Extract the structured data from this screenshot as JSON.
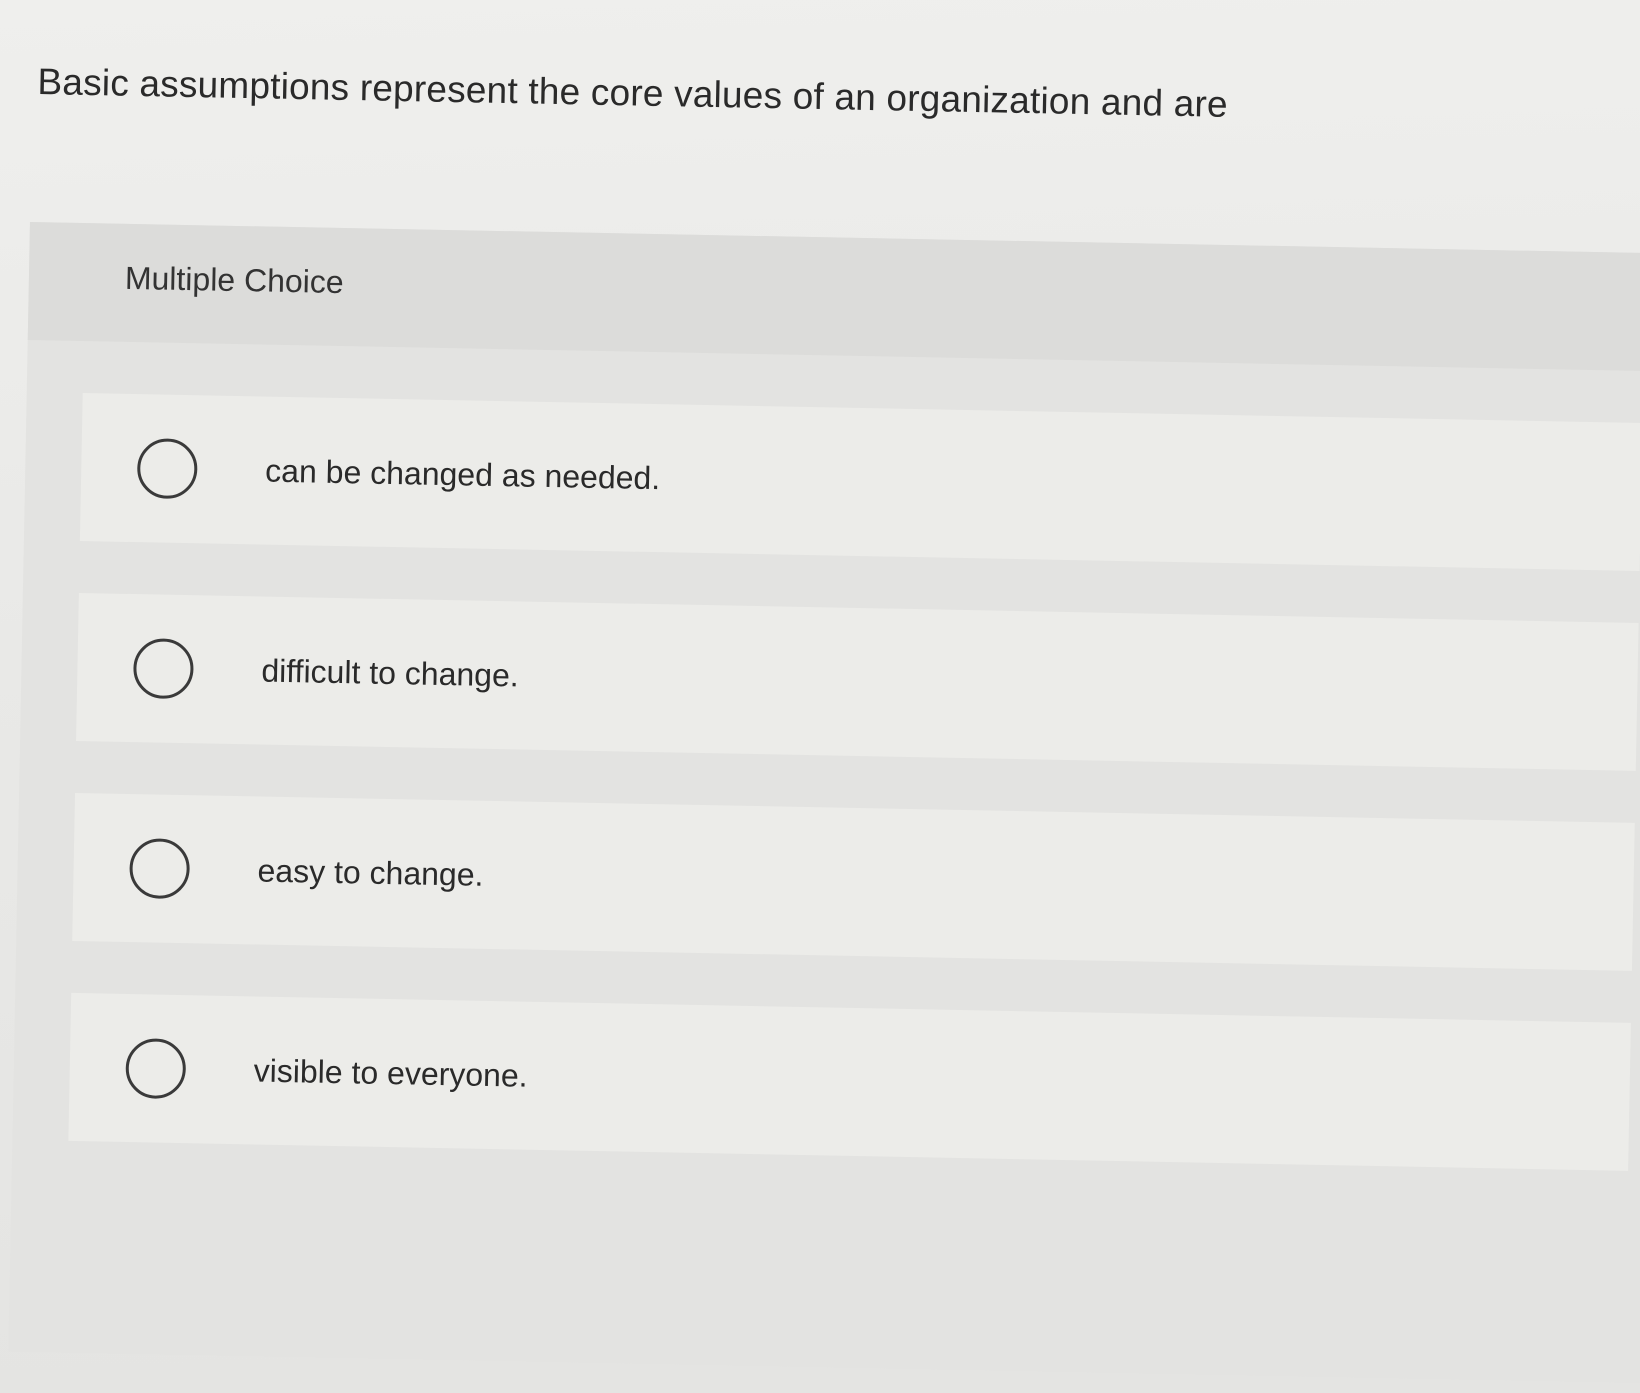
{
  "question": {
    "text": "Basic assumptions represent the core values of an organization and are"
  },
  "multiple_choice": {
    "label": "Multiple Choice",
    "options": [
      {
        "text": "can be changed as needed.",
        "selected": false
      },
      {
        "text": "difficult to change.",
        "selected": false
      },
      {
        "text": "easy to change.",
        "selected": false
      },
      {
        "text": "visible to everyone.",
        "selected": false
      }
    ]
  }
}
